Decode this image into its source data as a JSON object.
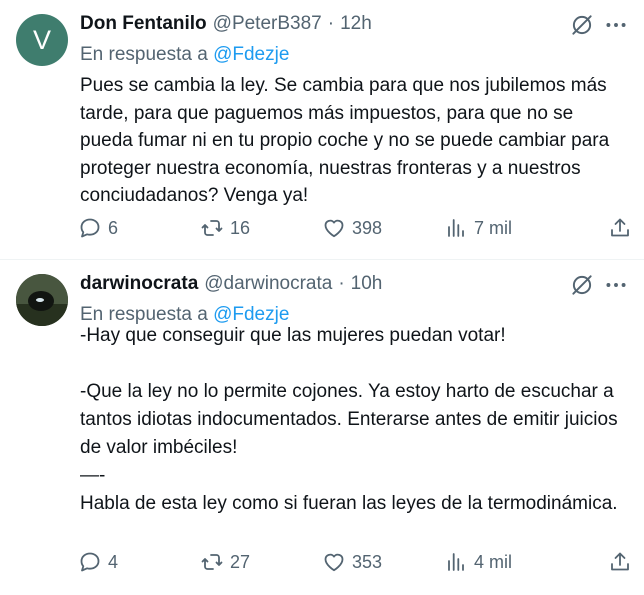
{
  "tweets": [
    {
      "avatar_letter": "V",
      "avatar_color": "#3f7d6e",
      "name": "Don Fentanilo",
      "handle": "@PeterB387",
      "separator": "·",
      "time": "12h",
      "reply_prefix": "En respuesta a",
      "reply_mention": "@Fdezje",
      "text": "Pues se cambia la ley. Se cambia para que nos jubilemos más tarde, para que paguemos más impuestos, para que no se pueda fumar ni en tu propio coche y no se puede cambiar para proteger nuestra economía, nuestras fronteras y a nuestros conciudadanos? Venga ya!",
      "stats": {
        "replies": "6",
        "reposts": "16",
        "likes": "398",
        "views": "7 mil"
      }
    },
    {
      "name": "darwinocrata",
      "handle": "@darwinocrata",
      "separator": "·",
      "time": "10h",
      "reply_prefix": "En respuesta a",
      "reply_mention": "@Fdezje",
      "text": "-Hay que conseguir que las mujeres puedan votar!\n\n-Que la ley no lo permite cojones. Ya estoy harto de escuchar a tantos idiotas indocumentados. Enterarse antes de emitir juicios de valor imbéciles!\n—-\nHabla de esta ley como si fueran las leyes de la termodinámica.",
      "stats": {
        "replies": "4",
        "reposts": "27",
        "likes": "353",
        "views": "4 mil"
      }
    }
  ],
  "colors": {
    "link": "#1d9bf0",
    "secondary": "#536471",
    "text": "#0f1419"
  },
  "icons": [
    "grok-icon",
    "more-icon",
    "reply-icon",
    "repost-icon",
    "like-icon",
    "views-icon",
    "share-icon"
  ]
}
